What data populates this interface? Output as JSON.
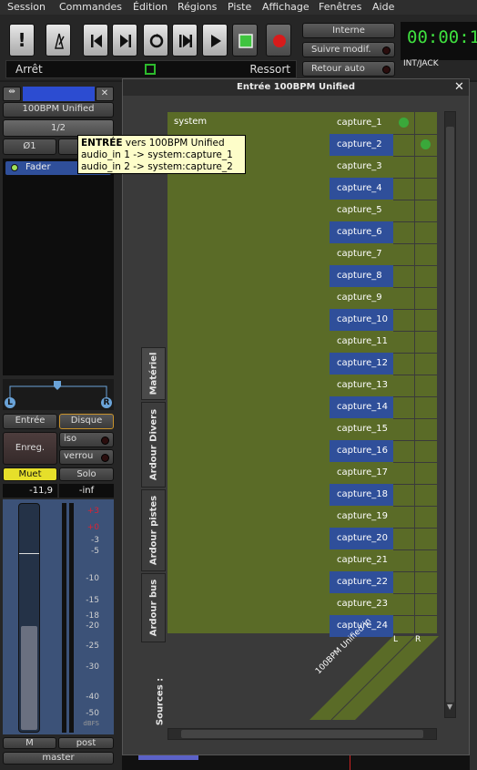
{
  "menubar": [
    "Session",
    "Commandes",
    "Édition",
    "Régions",
    "Piste",
    "Affichage",
    "Fenêtres",
    "Aide"
  ],
  "transport": {
    "clock": "00:00:1",
    "sync": "INT/JACK",
    "status_left": "Arrêt",
    "status_right": "Ressort",
    "interne_label": "Interne",
    "suivre_label": "Suivre modif.",
    "retour_label": "Retour auto"
  },
  "strip": {
    "name": "100BPM Unified",
    "input_button": "1/2",
    "phase_label": "Ø1",
    "fader_label": "Fader",
    "pan_left": "L",
    "pan_right": "R",
    "entree_label": "Entrée",
    "disque_label": "Disque",
    "enreg_label": "Enreg.",
    "iso_label": "iso",
    "verrou_label": "verrou",
    "muet_label": "Muet",
    "solo_label": "Solo",
    "gain_value": "-11,9",
    "peak_value": "-inf",
    "meter_ticks": [
      "+3",
      "+0",
      "-3",
      "-5",
      "-10",
      "-15",
      "-18",
      "-20",
      "-25",
      "-30",
      "-40",
      "-50",
      "dBFS"
    ],
    "meter_m_label": "M",
    "post_label": "post",
    "bus_label": "master"
  },
  "tooltip": {
    "title": "ENTRÉE",
    "title_rest": " vers 100BPM Unified",
    "line1": "audio_in 1 -> system:capture_1",
    "line2": "audio_in 2 -> system:capture_2"
  },
  "dialog": {
    "title": "Entrée 100BPM Unified",
    "group_label": "system",
    "sources_label": "Sources :",
    "destination_label": "100BPM Unified in",
    "col_labels": [
      "L",
      "R"
    ],
    "tabs": [
      "Matériel",
      "Ardour Divers",
      "Ardour pistes",
      "Ardour bus"
    ],
    "captures": [
      "capture_1",
      "capture_2",
      "capture_3",
      "capture_4",
      "capture_5",
      "capture_6",
      "capture_7",
      "capture_8",
      "capture_9",
      "capture_10",
      "capture_11",
      "capture_12",
      "capture_13",
      "capture_14",
      "capture_15",
      "capture_16",
      "capture_17",
      "capture_18",
      "capture_19",
      "capture_20",
      "capture_21",
      "capture_22",
      "capture_23",
      "capture_24"
    ],
    "connections": [
      [
        0,
        0
      ],
      [
        1,
        1
      ]
    ]
  },
  "colors": {
    "group_green": "#5a6b27",
    "row_blue": "#2f4f9a",
    "connected_dot": "#3aa83a",
    "clock_green": "#3fe03f",
    "record_red": "#d81b1b",
    "mute_yellow": "#e6df2a"
  }
}
